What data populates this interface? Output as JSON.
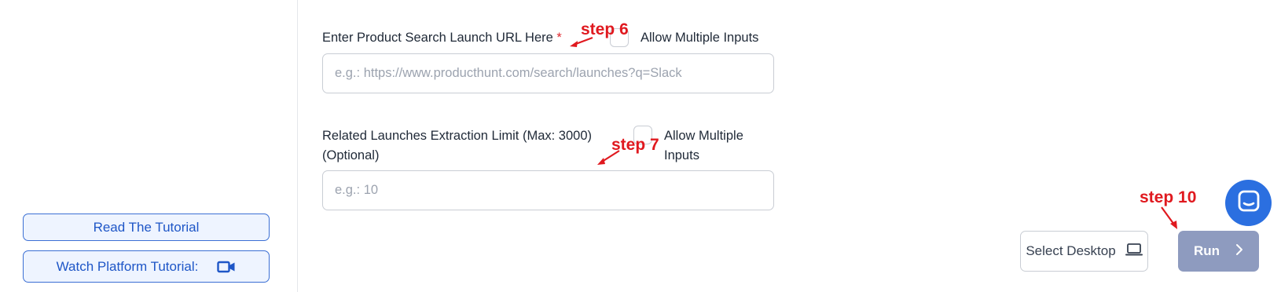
{
  "sidebar": {
    "read_tutorial": "Read The Tutorial",
    "watch_tutorial": "Watch Platform Tutorial:"
  },
  "form": {
    "url_field": {
      "label": "Enter Product Search Launch URL Here",
      "required_mark": "*",
      "allow_multiple_label": "Allow Multiple Inputs",
      "placeholder": "e.g.: https://www.producthunt.com/search/launches?q=Slack",
      "value": ""
    },
    "limit_field": {
      "label_line1": "Related Launches Extraction Limit (Max: 3000)",
      "label_line2": "(Optional)",
      "allow_multiple_line1": "Allow Multiple",
      "allow_multiple_line2": "Inputs",
      "placeholder": "e.g.: 10",
      "value": ""
    }
  },
  "annotations": {
    "step6": "step 6",
    "step7": "step 7",
    "step10": "step 10"
  },
  "actions": {
    "select_desktop": "Select Desktop",
    "run": "Run"
  },
  "icons": {
    "video": "video-camera-icon",
    "laptop": "laptop-icon",
    "chevron": "chevron-right-icon",
    "chat": "chat-icon"
  },
  "colors": {
    "accent_blue": "#1e56c7",
    "annotation_red": "#e0191f",
    "run_button": "#8e9bbf",
    "chat_bubble": "#2b6fe0"
  }
}
